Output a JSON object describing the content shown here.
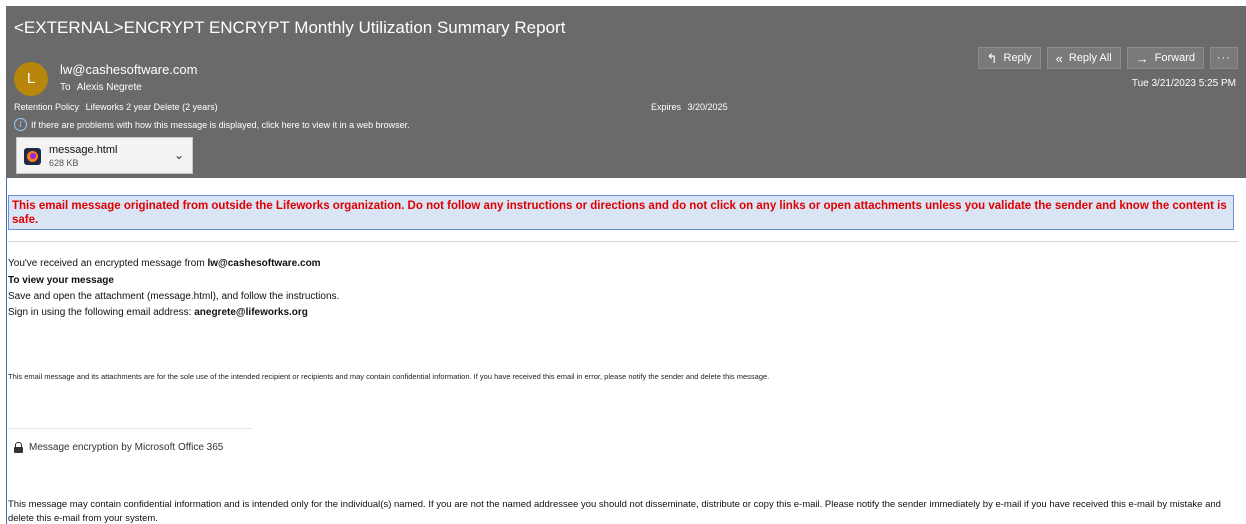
{
  "email": {
    "subject": "<EXTERNAL>ENCRYPT ENCRYPT Monthly Utilization Summary Report",
    "avatar_initial": "L",
    "sender": "lw@cashesoftware.com",
    "to_label": "To",
    "to_name": "Alexis Negrete",
    "datetime": "Tue 3/21/2023 5:25 PM",
    "retention_label": "Retention Policy",
    "retention_value": "Lifeworks 2 year Delete (2 years)",
    "expires_label": "Expires",
    "expires_value": "3/20/2025",
    "info_text": "If there are problems with how this message is displayed, click here to view it in a web browser."
  },
  "toolbar": {
    "reply_label": "Reply",
    "reply_all_label": "Reply All",
    "forward_label": "Forward",
    "more_label": "···"
  },
  "attachment": {
    "name": "message.html",
    "size": "628 KB"
  },
  "body": {
    "warning": "This email message originated from outside the Lifeworks organization. Do not follow any instructions or directions and do not click on any links or open attachments unless you validate the sender and know the content is safe.",
    "received_prefix": "You've received an encrypted message from ",
    "received_sender": "lw@cashesoftware.com",
    "view_heading": "To view your message",
    "instruction": "Save and open the attachment (message.html), and follow the instructions.",
    "signin_prefix": "Sign in using the following email address: ",
    "signin_email": "anegrete@lifeworks.org",
    "footer_note": "This email message and its attachments are for the sole use of the intended recipient or recipients and may contain confidential information. If you have received this email in error, please notify the sender and delete this message.",
    "encryption_text": "Message encryption by Microsoft Office 365",
    "disclaimer": "This message may contain confidential information and is intended only for the individual(s) named. If you are not the named addressee you should not disseminate, distribute or copy this e-mail. Please notify the sender immediately by e-mail if you have received this e-mail by mistake and delete this e-mail from your system."
  },
  "colors": {
    "header_bg": "#6a6a6a",
    "avatar_bg": "#b8860b",
    "warning_text": "#e00000",
    "warning_bg": "#d9e4f5"
  }
}
